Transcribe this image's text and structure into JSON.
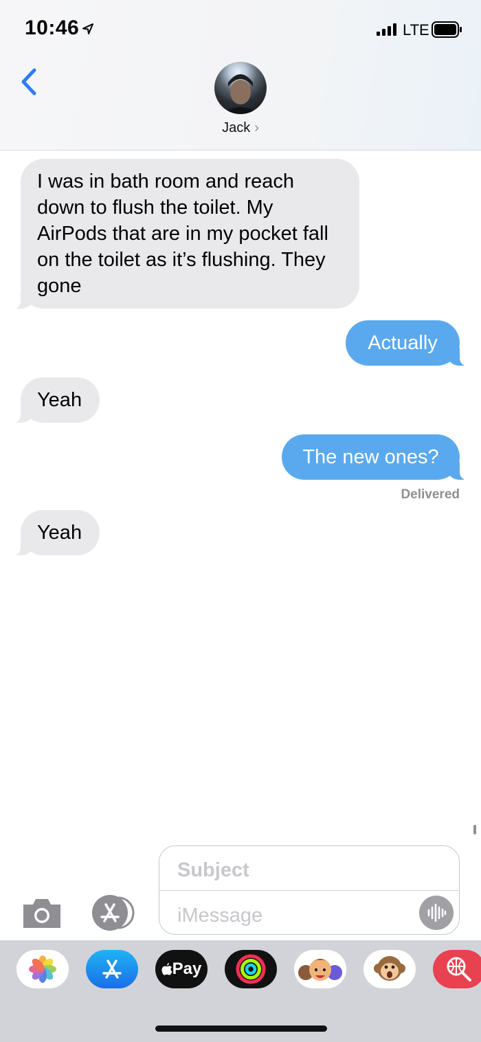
{
  "status_bar": {
    "time": "10:46",
    "network": "LTE",
    "icons": [
      "location-arrow-icon",
      "cellular-signal-icon",
      "battery-icon"
    ]
  },
  "header": {
    "contact_name": "Jack",
    "chevron": "›",
    "icons": [
      "back-chevron-icon",
      "contact-avatar"
    ]
  },
  "messages": [
    {
      "direction": "incoming",
      "text": "I was in bath room and reach down to flush the toilet. My AirPods that are in my pocket fall on the toilet as it’s flushing. They gone"
    },
    {
      "direction": "outgoing",
      "text": "Actually"
    },
    {
      "direction": "incoming",
      "text": "Yeah"
    },
    {
      "direction": "outgoing",
      "text": "The new ones?"
    },
    {
      "direction": "incoming",
      "text": "Yeah"
    }
  ],
  "delivery_status": "Delivered",
  "compose": {
    "subject_placeholder": "Subject",
    "message_placeholder": "iMessage"
  },
  "app_drawer": {
    "apps": [
      "photos-app-icon",
      "app-store-icon",
      "apple-pay-icon",
      "activity-app-icon",
      "memoji-icon",
      "animoji-icon",
      "web-images-search-icon"
    ],
    "apple_pay_label": "Pay"
  },
  "colors": {
    "incoming_bubble": "#e9e9eb",
    "outgoing_bubble": "#5aa9ee",
    "ios_blue": "#2f7bf5",
    "drawer_background": "#d2d3d9"
  }
}
